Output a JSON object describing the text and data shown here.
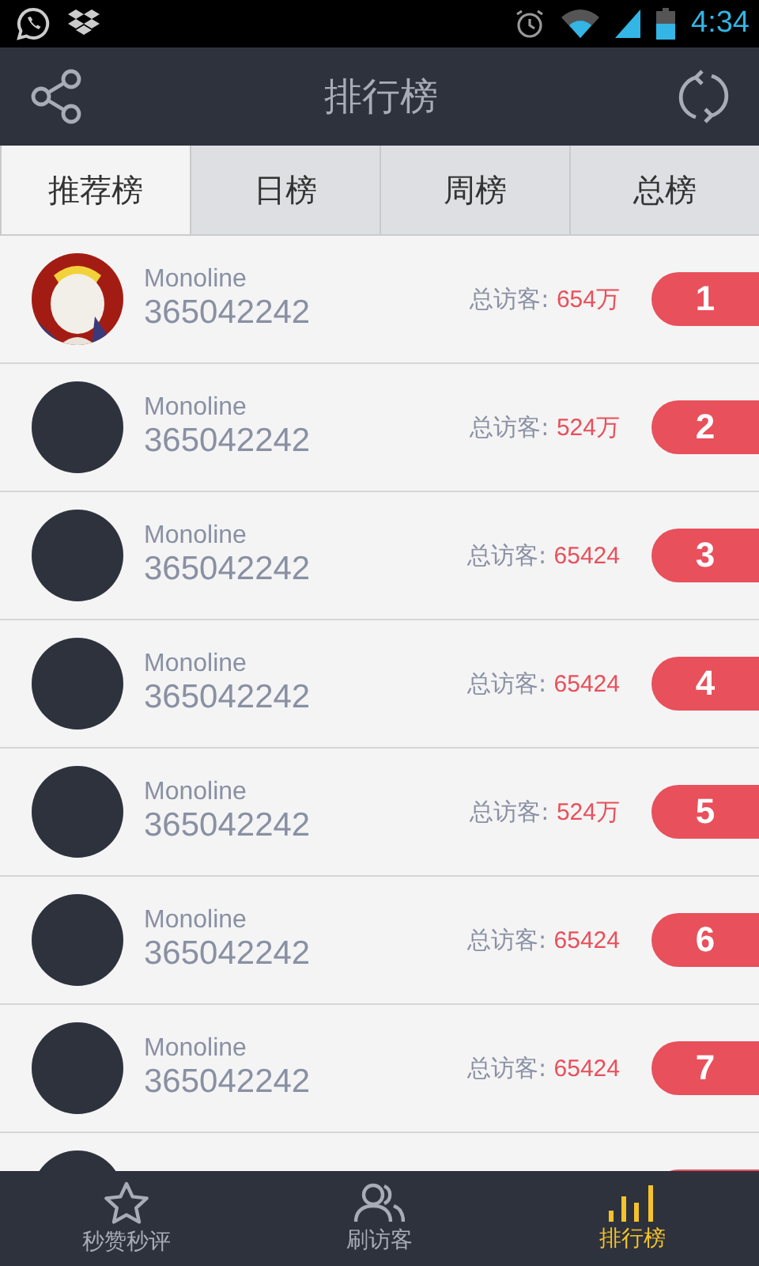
{
  "status_bar": {
    "time": "4:34"
  },
  "app_bar": {
    "title": "排行榜"
  },
  "tabs": [
    {
      "label": "推荐榜",
      "selected": true
    },
    {
      "label": "日榜",
      "selected": false
    },
    {
      "label": "周榜",
      "selected": false
    },
    {
      "label": "总榜",
      "selected": false
    }
  ],
  "rows": [
    {
      "name": "Monoline",
      "id": "365042242",
      "visitors_label": "总访客:",
      "visitors": "654万",
      "rank": "1"
    },
    {
      "kind": "plain",
      "name": "Monoline",
      "id": "365042242",
      "visitors_label": "总访客:",
      "visitors": "524万",
      "rank": "2"
    },
    {
      "kind": "plain",
      "name": "Monoline",
      "id": "365042242",
      "visitors_label": "总访客:",
      "visitors": "65424",
      "rank": "3"
    },
    {
      "kind": "plain",
      "name": "Monoline",
      "id": "365042242",
      "visitors_label": "总访客:",
      "visitors": "65424",
      "rank": "4"
    },
    {
      "kind": "plain",
      "name": "Monoline",
      "id": "365042242",
      "visitors_label": "总访客:",
      "visitors": "524万",
      "rank": "5"
    },
    {
      "kind": "plain",
      "name": "Monoline",
      "id": "365042242",
      "visitors_label": "总访客:",
      "visitors": "65424",
      "rank": "6"
    },
    {
      "kind": "plain",
      "name": "Monoline",
      "id": "365042242",
      "visitors_label": "总访客:",
      "visitors": "65424",
      "rank": "7"
    },
    {
      "kind": "plain"
    }
  ],
  "bottom_nav": [
    {
      "label": "秒赞秒评",
      "kind": "star",
      "selected": false
    },
    {
      "label": "刷访客",
      "kind": "people",
      "selected": false
    },
    {
      "label": "排行榜",
      "kind": "bars",
      "selected": true
    }
  ]
}
